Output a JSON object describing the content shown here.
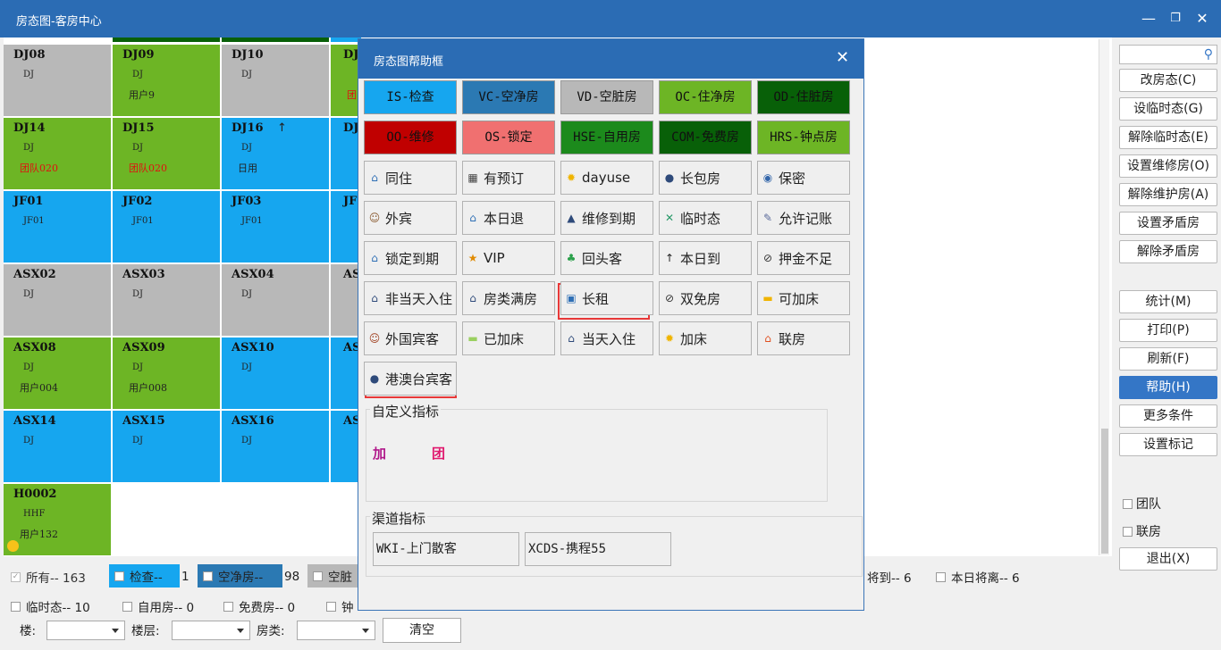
{
  "window": {
    "title": "房态图-客房中心"
  },
  "rooms": [
    {
      "no": "DJ08",
      "type": "DJ",
      "note": "",
      "color": "#b8b8b8"
    },
    {
      "no": "DJ09",
      "type": "DJ",
      "note": "用户9",
      "color": "#6db525"
    },
    {
      "no": "DJ10",
      "type": "DJ",
      "note": "",
      "color": "#b8b8b8"
    },
    {
      "no": "DJ14",
      "type": "DJ",
      "note": "团队020",
      "color": "#6db525"
    },
    {
      "no": "DJ15",
      "type": "DJ",
      "note": "团队020",
      "color": "#6db525"
    },
    {
      "no": "DJ16",
      "type": "DJ",
      "note": "日用",
      "color": "#16a6ef"
    },
    {
      "no": "JF01",
      "type": "JF01",
      "note": "",
      "color": "#16a6ef"
    },
    {
      "no": "JF02",
      "type": "JF01",
      "note": "",
      "color": "#16a6ef"
    },
    {
      "no": "JF03",
      "type": "JF01",
      "note": "",
      "color": "#16a6ef"
    },
    {
      "no": "ASX02",
      "type": "DJ",
      "note": "",
      "color": "#b8b8b8"
    },
    {
      "no": "ASX03",
      "type": "DJ",
      "note": "",
      "color": "#b8b8b8"
    },
    {
      "no": "ASX04",
      "type": "DJ",
      "note": "",
      "color": "#b8b8b8"
    },
    {
      "no": "ASX08",
      "type": "DJ",
      "note": "用户004",
      "color": "#6db525"
    },
    {
      "no": "ASX09",
      "type": "DJ",
      "note": "用户008",
      "color": "#6db525"
    },
    {
      "no": "ASX10",
      "type": "DJ",
      "note": "",
      "color": "#16a6ef"
    },
    {
      "no": "ASX14",
      "type": "DJ",
      "note": "",
      "color": "#16a6ef"
    },
    {
      "no": "ASX15",
      "type": "DJ",
      "note": "",
      "color": "#16a6ef"
    },
    {
      "no": "ASX16",
      "type": "DJ",
      "note": "",
      "color": "#16a6ef"
    },
    {
      "no": "H0002",
      "type": "HHF",
      "note": "用户132",
      "color": "#6db525"
    }
  ],
  "partial": {
    "dj11": "DJ",
    "dj11_note": "团",
    "dj17": "DJ",
    "jf04": "JF",
    "asx05": "AS",
    "asx11": "AS",
    "asx17": "AS",
    "dj16_mark": "↑"
  },
  "right": {
    "buttons": [
      "改房态(C)",
      "设临时态(G)",
      "解除临时态(E)",
      "设置维修房(O)",
      "解除维护房(A)",
      "设置矛盾房",
      "解除矛盾房"
    ],
    "buttons2": [
      "统计(M)",
      "打印(P)",
      "刷新(F)",
      "帮助(H)",
      "更多条件",
      "设置标记"
    ],
    "checks": [
      "团队",
      "联房"
    ],
    "exit": "退出(X)"
  },
  "bottom": {
    "all": "所有-- 163",
    "check": "检查--",
    "check_n": "1",
    "vc": "空净房--",
    "vc_n": "98",
    "vd": "空脏",
    "arriving": "将到-- 6",
    "leaving": "本日将离-- 6",
    "temp": "临时态-- 10",
    "self": "自用房-- 0",
    "free": "免费房-- 0",
    "hour": "钟",
    "building_label": "楼:",
    "floor_label": "楼层:",
    "roomtype_label": "房类:",
    "clear": "清空"
  },
  "dialog": {
    "title": "房态图帮助框",
    "states": [
      {
        "label": "IS-检查",
        "bg": "#16a6ef",
        "fg": "#111"
      },
      {
        "label": "VC-空净房",
        "bg": "#2b79b3",
        "fg": "#111"
      },
      {
        "label": "VD-空脏房",
        "bg": "#b8b8b8",
        "fg": "#111"
      },
      {
        "label": "OC-住净房",
        "bg": "#6db525",
        "fg": "#111"
      },
      {
        "label": "OD-住脏房",
        "bg": "#086008",
        "fg": "#111"
      },
      {
        "label": "OO-维修",
        "bg": "#c00000",
        "fg": "#111"
      },
      {
        "label": "OS-锁定",
        "bg": "#f07070",
        "fg": "#111"
      },
      {
        "label": "HSE-自用房",
        "bg": "#1c8a1c",
        "fg": "#111"
      },
      {
        "label": "COM-免费房",
        "bg": "#086008",
        "fg": "#111"
      },
      {
        "label": "HRS-钟点房",
        "bg": "#6db525",
        "fg": "#111"
      }
    ],
    "icons": [
      {
        "label": "同住",
        "icon": "house-person-icon",
        "glyph": "⌂"
      },
      {
        "label": "有预订",
        "icon": "calendar-icon",
        "glyph": "▦"
      },
      {
        "label": "dayuse",
        "icon": "sun-icon",
        "glyph": "✹"
      },
      {
        "label": "长包房",
        "icon": "person-clock-icon",
        "glyph": "●"
      },
      {
        "label": "保密",
        "icon": "lock-icon",
        "glyph": "◉"
      },
      {
        "label": "外宾",
        "icon": "foreigner-icon",
        "glyph": "☺"
      },
      {
        "label": "本日退",
        "icon": "house-out-icon",
        "glyph": "⌂"
      },
      {
        "label": "维修到期",
        "icon": "repair-expire-icon",
        "glyph": "▲"
      },
      {
        "label": "临时态",
        "icon": "tools-icon",
        "glyph": "✕"
      },
      {
        "label": "允许记账",
        "icon": "pen-icon",
        "glyph": "✎"
      },
      {
        "label": "锁定到期",
        "icon": "lock-expire-icon",
        "glyph": "⌂"
      },
      {
        "label": "VIP",
        "icon": "vip-icon",
        "glyph": "★"
      },
      {
        "label": "回头客",
        "icon": "returning-guest-icon",
        "glyph": "♣"
      },
      {
        "label": "本日到",
        "icon": "arrive-today-icon",
        "glyph": "↑"
      },
      {
        "label": "押金不足",
        "icon": "deposit-low-icon",
        "glyph": "⊘"
      },
      {
        "label": "非当天入住",
        "icon": "not-today-checkin-icon",
        "glyph": "⌂"
      },
      {
        "label": "房类满房",
        "icon": "roomtype-full-icon",
        "glyph": "⌂"
      },
      {
        "label": "长租",
        "icon": "long-rent-icon",
        "glyph": "▣"
      },
      {
        "label": "双免房",
        "icon": "double-free-icon",
        "glyph": "⊘"
      },
      {
        "label": "可加床",
        "icon": "bed-add-icon",
        "glyph": "▬"
      },
      {
        "label": "外国宾客",
        "icon": "foreign-guest-icon",
        "glyph": "☺"
      },
      {
        "label": "已加床",
        "icon": "bed-added-icon",
        "glyph": "▬"
      },
      {
        "label": "当天入住",
        "icon": "today-checkin-icon",
        "glyph": "⌂"
      },
      {
        "label": "加床",
        "icon": "extra-bed-icon",
        "glyph": "✹"
      },
      {
        "label": "联房",
        "icon": "linked-room-icon",
        "glyph": "⌂"
      },
      {
        "label": "港澳台宾客",
        "icon": "hmt-guest-icon",
        "glyph": "●"
      }
    ],
    "custom_label": "自定义指标",
    "custom_a": "加",
    "custom_b": "团",
    "channel_label": "渠道指标",
    "channels": [
      "WKI-上门散客",
      "XCDS-携程55"
    ]
  },
  "colors": {
    "title_bar": "#2b6cb4",
    "active_button": "#3476c6",
    "highlight": "#e83838"
  }
}
